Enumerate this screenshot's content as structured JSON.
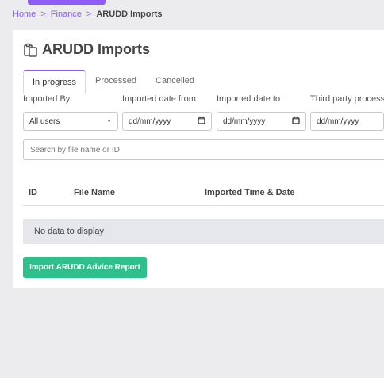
{
  "breadcrumb": {
    "items": [
      "Home",
      "Finance"
    ],
    "separator": ">",
    "current": "ARUDD Imports"
  },
  "page": {
    "title": "ARUDD Imports",
    "title_icon": "clipboard-copy-icon"
  },
  "tabs": [
    {
      "label": "In progress",
      "active": true
    },
    {
      "label": "Processed",
      "active": false
    },
    {
      "label": "Cancelled",
      "active": false
    }
  ],
  "filters": {
    "imported_by": {
      "label": "Imported By",
      "value": "All users"
    },
    "date_from": {
      "label": "Imported date from",
      "value": "dd/mm/yyyy"
    },
    "date_to": {
      "label": "Imported date to",
      "value": "dd/mm/yyyy"
    },
    "third_party": {
      "label": "Third party processi",
      "value": "dd/mm/yyyy"
    }
  },
  "search": {
    "placeholder": "Search by file name or ID"
  },
  "table": {
    "columns": [
      "ID",
      "File Name",
      "Imported Time & Date"
    ],
    "empty_message": "No data to display"
  },
  "actions": {
    "import_label": "Import ARUDD Advice Report"
  },
  "colors": {
    "accent": "#8b5cf6",
    "primary_button": "#2fbf8c",
    "background": "#ececee"
  }
}
